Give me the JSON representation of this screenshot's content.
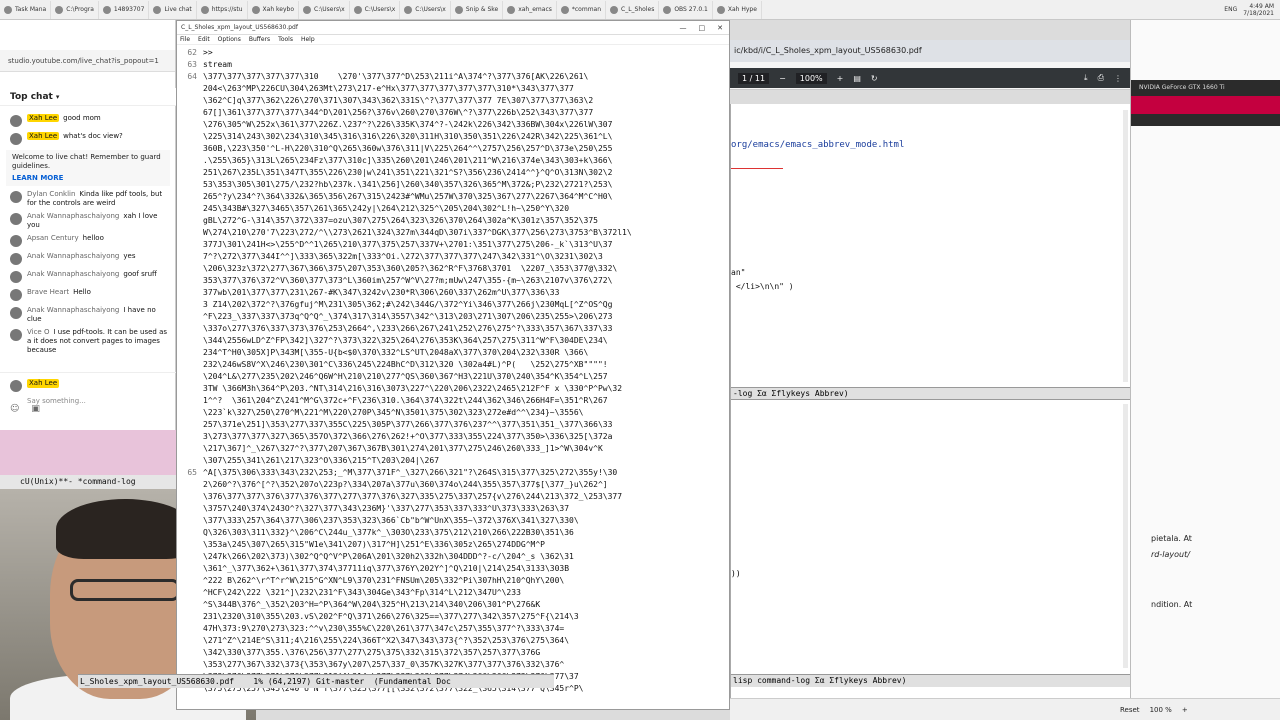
{
  "top_tabs": [
    {
      "label": "Task Mana"
    },
    {
      "label": "C:\\Progra"
    },
    {
      "label": "14893707"
    },
    {
      "label": "Live chat"
    },
    {
      "label": "https://stu"
    },
    {
      "label": "Xah keybo"
    },
    {
      "label": "C:\\Users\\x"
    },
    {
      "label": "C:\\Users\\x"
    },
    {
      "label": "C:\\Users\\x"
    },
    {
      "label": "Snip & Ske"
    },
    {
      "label": "xah_emacs"
    },
    {
      "label": "*comman"
    },
    {
      "label": "C_L_Sholes"
    },
    {
      "label": "OBS 27.0.1"
    },
    {
      "label": "Xah Hype"
    }
  ],
  "clock": {
    "time": "4:49 AM",
    "date": "7/18/2021",
    "lang": "ENG"
  },
  "chat": {
    "url": "studio.youtube.com/live_chat?is_popout=1",
    "title": "Top chat",
    "messages": [
      {
        "author": "Xah Lee",
        "owner": true,
        "text": "good mom"
      },
      {
        "author": "Xah Lee",
        "owner": true,
        "text": "what's doc view?"
      },
      {
        "author": "Dylan Conklin",
        "owner": false,
        "text": "Kinda like pdf tools, but for the controls are weird"
      },
      {
        "author": "Anak Wannaphaschaiyong",
        "owner": false,
        "text": "xah I love you"
      },
      {
        "author": "Apsan Century",
        "owner": false,
        "text": "helloo"
      },
      {
        "author": "Anak Wannaphaschaiyong",
        "owner": false,
        "text": "yes"
      },
      {
        "author": "Anak Wannaphaschaiyong",
        "owner": false,
        "text": "goof sruff"
      },
      {
        "author": "Brave Heart",
        "owner": false,
        "text": "Hello"
      },
      {
        "author": "Anak Wannaphaschaiyong",
        "owner": false,
        "text": "I have no clue"
      },
      {
        "author": "Vice O",
        "owner": false,
        "text": "I use pdf-tools. It can be used as a it does not convert pages to images because"
      }
    ],
    "system_notice": "Welcome to live chat! Remember to guard guidelines.",
    "learn_more": "LEARN MORE",
    "input_author": "Xah Lee",
    "input_placeholder": "Say something..."
  },
  "mode_left": "cU(Unix)**-   *command-log",
  "emacs": {
    "title": "C_L_Sholes_xpm_layout_US568630.pdf",
    "menu": [
      "File",
      "Edit",
      "Options",
      "Buffers",
      "Tools",
      "Help"
    ],
    "lines": [
      {
        "n": "62",
        "t": ">>"
      },
      {
        "n": "63",
        "t": "stream"
      },
      {
        "n": "64",
        "t": "\\377\\377\\377\\377\\377\\310    \\270'\\377\\377^D\\253\\211i^A\\374^?\\377\\376[AK\\226\\261\\"
      },
      {
        "n": "",
        "t": "204<\\263^MP\\226CU\\304\\263Mt\\273\\217-e^Hx\\377\\377\\377\\377\\377\\310*\\343\\377\\377"
      },
      {
        "n": "",
        "t": "\\362^C]q\\377\\362\\226\\270\\371\\307\\343\\362\\331S\\^?\\377\\377\\377 7E\\307\\377\\377\\363\\2"
      },
      {
        "n": "",
        "t": "67[]\\361\\377\\377\\377\\344^D\\201\\256?\\376v\\260\\270\\376W\\^?\\377\\226b\\252\\343\\377\\377"
      },
      {
        "n": "",
        "t": "\\276\\305^W\\252x\\361\\377\\226Z.\\237^?\\226\\335K\\374^?-\\242k\\226\\342\\336BW\\304x\\226lW\\307"
      },
      {
        "n": "",
        "t": "\\225\\314\\243\\302\\234\\310\\345\\316\\316\\226\\320\\311H\\310\\350\\351\\226\\242R\\342\\225\\361^L\\"
      },
      {
        "n": "",
        "t": "360B,\\223\\350'^L-H\\220\\310^Q\\265\\360w\\376\\311|V\\225\\264^^\\2757\\256\\257^D\\373e\\250\\255"
      },
      {
        "n": "",
        "t": ".\\255\\365}\\313L\\265\\234Fz\\377\\310c]\\335\\260\\201\\246\\201\\211^W\\216\\374e\\343\\303+k\\366\\"
      },
      {
        "n": "",
        "t": "251\\267\\235L\\351\\347T\\355\\226\\230|w\\241\\351\\221\\321^S?\\356\\236\\2414^^}^Q^O\\313N\\302\\2"
      },
      {
        "n": "",
        "t": "53\\353\\305\\301\\275/\\232?hb\\237k.\\341\\256]\\260\\340\\357\\326\\365^M\\372&;P\\232\\2721?\\253\\"
      },
      {
        "n": "",
        "t": "265^?y\\234^?\\364\\332&\\365\\356\\267\\315\\2423#^WMu\\257W\\370\\325\\367\\277\\2267\\364^M^C^H0\\"
      },
      {
        "n": "",
        "t": "245\\343B#\\327\\3465\\357\\261\\365\\242y|\\264\\212\\325^\\205\\204\\302^L!h~\\250^Y\\320"
      },
      {
        "n": "",
        "t": "gBL\\272^G-\\314\\357\\372\\337=ozu\\307\\275\\264\\323\\326\\370\\264\\302a^K\\301z\\357\\352\\375"
      },
      {
        "n": "",
        "t": "W\\274\\210\\270'7\\223\\272/^\\\\273\\2621\\324\\327m\\344qD\\307i\\337^DGK\\377\\256\\273\\3753^B\\372l1\\"
      },
      {
        "n": "",
        "t": "377J\\301\\241H<>\\255^D^^1\\265\\210\\377\\375\\257\\337V+\\2701:\\351\\377\\275\\206-_k`\\313^U\\37"
      },
      {
        "n": "",
        "t": "7^?\\272\\377\\344I^^]\\333\\365\\322m[\\333^Oi.\\272\\377\\377\\377\\247\\342\\331^\\O\\3231\\302\\3"
      },
      {
        "n": "",
        "t": "\\206\\323z\\372\\277\\367\\366\\375\\207\\353\\360\\205?\\362^R^F\\3768\\3701  \\2207_\\353\\377@\\332\\"
      },
      {
        "n": "",
        "t": "353\\377\\376\\372^V\\360\\377\\373^L\\360im\\257^W^V\\27?m;mUw\\247\\355-{m~\\263\\2107v\\376\\272\\"
      },
      {
        "n": "",
        "t": "377wb\\201\\377\\377\\231\\267-#K\\347\\3242v\\230*R\\306\\260\\337\\262m^U\\377\\336\\33"
      },
      {
        "n": "",
        "t": "3 Z14\\202\\372^?\\376gfuj^M\\231\\305\\362;#\\242\\344G/\\372^Yi\\346\\377\\266j\\230MqL[^Z^OS^Qg"
      },
      {
        "n": "",
        "t": "^F\\223_\\337\\337\\373q^Q^Q^_\\374\\317\\314\\3557\\342^\\313\\203\\271\\307\\206\\235\\255>\\206\\273"
      },
      {
        "n": "",
        "t": "\\337o\\277\\376\\337\\373\\376\\253\\2664^,\\233\\266\\267\\241\\252\\276\\275^?\\333\\357\\367\\337\\33"
      },
      {
        "n": "",
        "t": "\\344\\2556wLD^Z^FP\\342]\\327^?\\373\\322\\325\\264\\276\\353K\\364\\257\\275\\311^W^F\\304DE\\234\\"
      },
      {
        "n": "",
        "t": "234^T^H0\\305X]P\\343M[\\355-U{b<$0\\370\\332^LS^UT\\2048aX\\377\\370\\204\\232\\330R \\366\\"
      },
      {
        "n": "",
        "t": "232\\246wS8V^X\\246\\230\\301^C\\336\\245\\224BhC^D\\312\\320 \\302a4#L)^P(   \\252\\275^XB\"\"\"\"!"
      },
      {
        "n": "",
        "t": "\\204^L&\\277\\235\\202\\246^Q6W^H\\210\\210\\277^QS\\360\\367^H3\\221U\\370\\240\\354^K\\354^L\\257"
      },
      {
        "n": "",
        "t": "3TW \\366M3h\\364^P\\203.^NT\\314\\216\\316\\3073\\227^\\220\\206\\2322\\2465\\212F^F x \\330^P^Pw\\32"
      },
      {
        "n": "",
        "t": "1^^?  \\361\\204^Z\\241^M^G\\372c+^F\\236\\310.\\364\\374\\322t\\244\\362\\346\\266H4F=\\351^R\\267"
      },
      {
        "n": "",
        "t": "\\223`k\\327\\250\\270^M\\221^M\\220\\270P\\345^N\\3501\\375\\302\\323\\272e#d^^\\234}~\\3556\\"
      },
      {
        "n": "",
        "t": "257\\371e\\251]\\353\\277\\337\\355C\\225\\305P\\377\\266\\377\\376\\237^^\\377\\351\\351_\\377\\366\\33"
      },
      {
        "n": "",
        "t": "3\\273\\377\\377\\327\\365\\357O\\372\\366\\276\\262!+^O\\377\\333\\355\\224\\377\\350>\\336\\325[\\372a"
      },
      {
        "n": "",
        "t": "\\217\\367]^_\\267\\327^?\\377\\207\\367\\367B\\301\\274\\201\\377\\275\\246\\260\\333_]1>^W\\304v^K"
      },
      {
        "n": "",
        "t": "\\307\\255\\341\\261\\217\\323^O\\336\\215^T\\203\\204|\\267"
      },
      {
        "n": "65",
        "t": "^A[\\375\\306\\333\\343\\232\\253;_^M\\377\\371F^_\\327\\266\\321\"?\\264S\\315\\377\\325\\272\\355y!\\30"
      },
      {
        "n": "",
        "t": "2\\260^?\\376^[^?\\352\\207o\\223p?\\334\\207a\\377u\\360\\374o\\244\\355\\357\\377$[\\377_}u\\262^]"
      },
      {
        "n": "",
        "t": "\\376\\377\\377\\376\\377\\376\\377\\277\\377\\376\\327\\335\\275\\337\\257{v\\276\\244\\213\\372_\\253\\377"
      },
      {
        "n": "",
        "t": "\\3757\\240\\374\\243O^?\\327\\377\\343\\236M}'\\337\\277\\353\\337\\333^U\\373\\333\\263\\37"
      },
      {
        "n": "",
        "t": "\\377\\333\\257\\364\\377\\306\\237\\353\\323\\366`Cb\"b^W^UnX\\355~\\372\\376X\\341\\327\\330\\"
      },
      {
        "n": "",
        "t": "Q\\326\\303\\311\\332}^\\206^C\\244u_\\377k^_\\303O\\233\\375\\212\\210\\266\\222B30\\351\\36"
      },
      {
        "n": "",
        "t": "\\353a\\245\\307\\265\\315\"W1e\\341\\207)\\317^H]\\251^E\\336\\305z\\265\\274DDG^M^P"
      },
      {
        "n": "",
        "t": "\\247k\\266\\202\\373)\\302^Q^Q^V^P\\206A\\201\\320h2\\332h\\304DDD^?-c/\\204^_s \\362\\31"
      },
      {
        "n": "",
        "t": "\\361^_\\377\\362+\\361\\377\\374\\37711iq\\377\\376Y\\202Y^]^Q\\210|\\214\\254\\3133\\303B"
      },
      {
        "n": "",
        "t": "^222 B\\262^\\r^T^r^W\\215^G^XN^L9\\370\\231^FNSUm\\205\\332^Pi\\307hH\\210^QhY\\200\\"
      },
      {
        "n": "",
        "t": "^HCF\\242\\222 \\321^]\\232\\231^F\\343\\304Ge\\343^Fp\\314^L\\212\\347U^\\233"
      },
      {
        "n": "",
        "t": "^S\\344B\\376^_\\352\\203^H=^P\\364^W\\204\\325^H\\213\\214\\340\\206\\301^P\\276&K"
      },
      {
        "n": "",
        "t": "231\\2320\\310\\355\\203.vS\\202^F^Q\\371\\266\\276\\325==\\377\\277\\342\\357\\275^F{\\214\\3"
      },
      {
        "n": "",
        "t": "47H\\373:9\\270\\273\\323:^^v\\230\\355%C\\220\\261\\377\\347c\\257\\355\\377^?\\333\\374="
      },
      {
        "n": "",
        "t": "\\271^Z^\\214E^S\\311;4\\216\\255\\224\\366T^X2\\347\\343\\373{^?\\352\\253\\376\\275\\364\\"
      },
      {
        "n": "",
        "t": "\\342\\330\\377\\355.\\376\\256\\377\\277\\275\\375\\332\\315\\372\\357\\257\\377\\376G"
      },
      {
        "n": "",
        "t": "\\353\\277\\367\\332\\373{\\353\\367y\\207\\257\\337_0\\357K\\327K\\377\\377\\376\\332\\376^"
      },
      {
        "n": "",
        "t": "\\372\\376\\277\\371\\376\\277\\313^]\\314;\\377\\337\\363\\377\\374\\260\\266\\372\\376\\377\\37"
      },
      {
        "n": "",
        "t": "\\375\\275\\257\\345\\240^U^N^T\\377\\325\\377[[\\332\\372\\377\\322_\\365\\314\\377^Q\\345r^P\\"
      }
    ],
    "modeline": "L_Sholes_xpm_layout_US568630.pdf    1% (64,2197) Git-master  (Fundamental Doc"
  },
  "pdf": {
    "tab": "C_L_Sholes_xpm_layout_US568630.pdf",
    "filename": "ic/kbd/i/C_L_Sholes_xpm_layout_US568630.pdf",
    "page": "1 / 11",
    "zoom": "100%"
  },
  "right_pane": {
    "url": "org/emacs/emacs_abbrev_mode.html",
    "code1": "an\"",
    "code2": " </li>\\n\\n\" )",
    "mode1": "-log Σα Σflykeys Abbrev)",
    "code3": "))",
    "mode2": "lisp command-log Σα Σflykeys Abbrev)"
  },
  "far_right": {
    "gpu": "NVIDIA GeForce GTX 1660 Ti",
    "line1": "pietala. At",
    "line2": "rd-layout/",
    "line3": "ndition. At"
  },
  "tray": [
    "Reset",
    "100 %",
    "+"
  ]
}
